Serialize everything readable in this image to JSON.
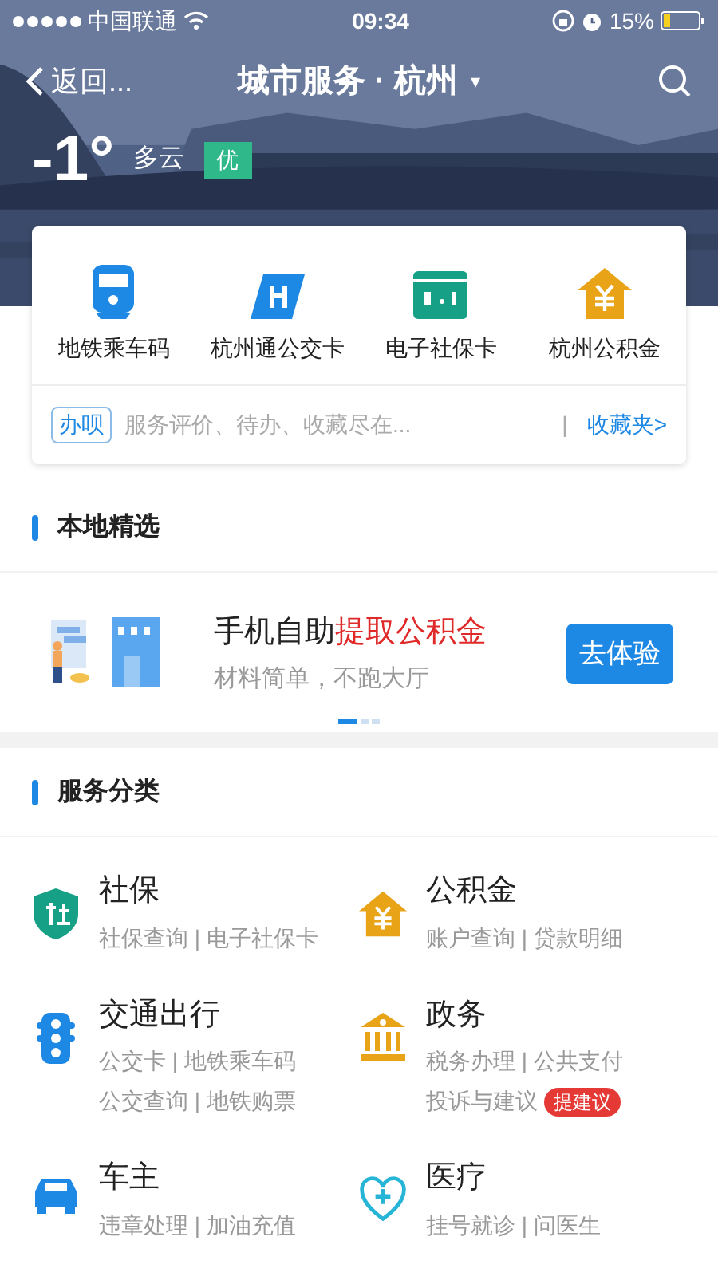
{
  "status_bar": {
    "carrier": "中国联通",
    "time": "09:34",
    "battery": "15%"
  },
  "nav": {
    "back": "返回...",
    "title": "城市服务 · 杭州",
    "caret": "▾"
  },
  "weather": {
    "temperature": "-1°",
    "condition": "多云",
    "air_quality": "优"
  },
  "shortcuts": [
    {
      "kind": "metro",
      "label": "地铁乘车码"
    },
    {
      "kind": "bus",
      "label": "杭州通公交卡"
    },
    {
      "kind": "social",
      "label": "电子社保卡"
    },
    {
      "kind": "fund",
      "label": "杭州公积金"
    }
  ],
  "assistant": {
    "tag": "办呗",
    "hint": "服务评价、待办、收藏尽在...",
    "divider": "|",
    "link": "收藏夹>"
  },
  "featured": {
    "title": "本地精选",
    "headline": "手机自助",
    "highlight": "提取公积金",
    "subtitle": "材料简单，不跑大厅",
    "button": "去体验",
    "pages": [
      {
        "selected": true
      },
      {
        "selected": false
      },
      {
        "selected": false
      }
    ]
  },
  "categories": {
    "title": "服务分类",
    "items": [
      {
        "kind": "shield",
        "title": "社保",
        "lines": [
          "社保查询 | 电子社保卡"
        ]
      },
      {
        "kind": "fund",
        "title": "公积金",
        "lines": [
          "账户查询 | 贷款明细"
        ]
      },
      {
        "kind": "traffic",
        "title": "交通出行",
        "lines": [
          "公交卡 | 地铁乘车码",
          "公交查询 | 地铁购票"
        ]
      },
      {
        "kind": "gov",
        "title": "政务",
        "lines": [
          "税务办理 | 公共支付",
          "投诉与建议"
        ],
        "badge": "提建议"
      },
      {
        "kind": "car",
        "title": "车主",
        "lines": [
          "违章处理 | 加油充值"
        ]
      },
      {
        "kind": "medical",
        "title": "医疗",
        "lines": [
          "挂号就诊 | 问医生"
        ]
      }
    ]
  }
}
